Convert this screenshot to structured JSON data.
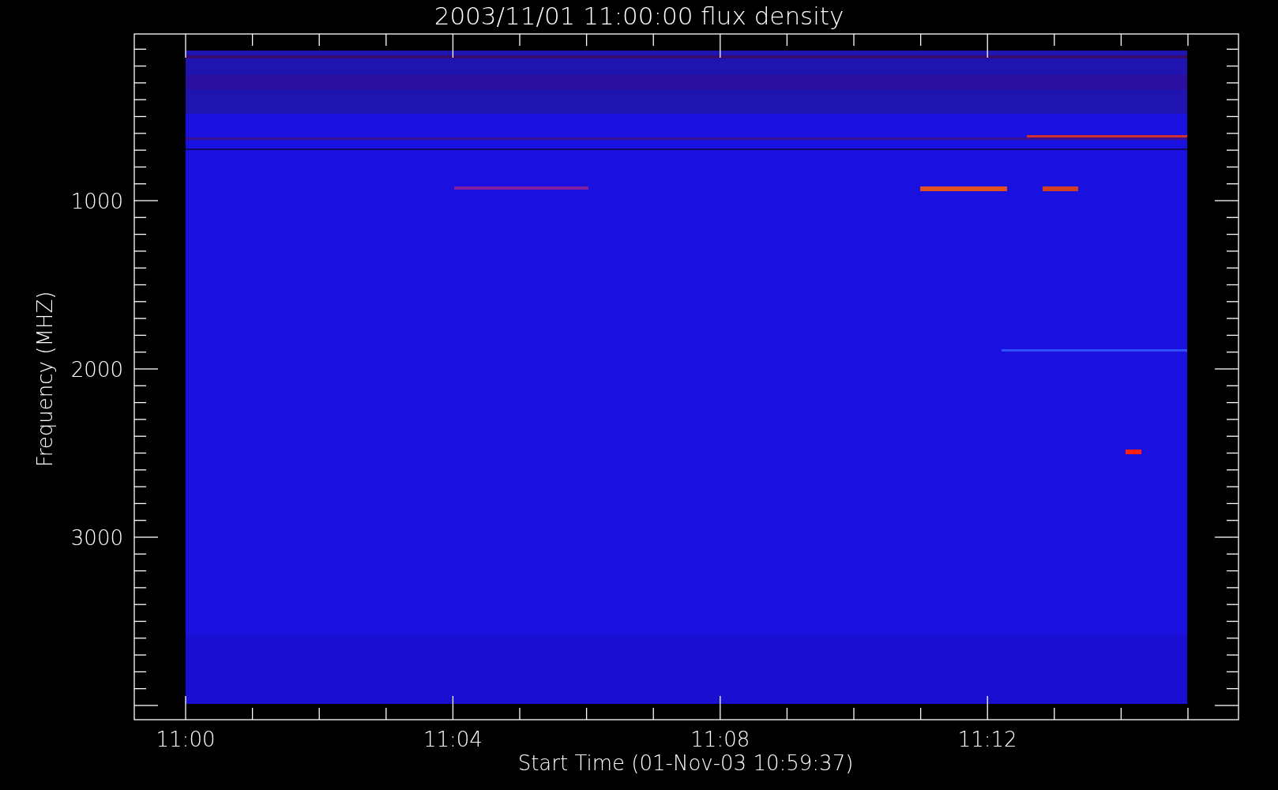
{
  "title": "2003/11/01 11:00:00 flux density",
  "y_axis": {
    "label": "Frequency (MHZ)",
    "ticks": [
      "1000",
      "2000",
      "3000"
    ]
  },
  "x_axis": {
    "label": "Start Time (01-Nov-03 10:59:37)",
    "ticks": [
      "11:00",
      "11:04",
      "11:08",
      "11:12"
    ]
  }
}
